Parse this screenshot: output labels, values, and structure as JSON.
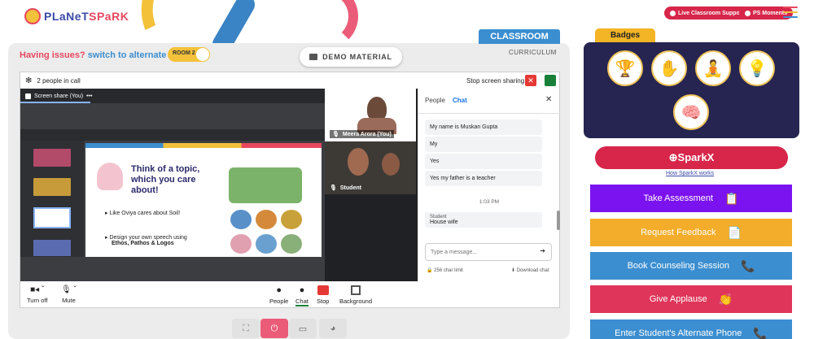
{
  "header": {
    "logo_text_a": "PLaNeT",
    "logo_text_b": "SPaRK",
    "live_support": "Live Classroom Support",
    "ps_moments": "PS Moments"
  },
  "classroom": {
    "tab_label": "CLASSROOM",
    "curriculum_label": "CURRICULUM",
    "issue_text": "Having issues?",
    "issue_link": "switch to alternate room",
    "room_toggle": "ROOM 2",
    "demo_material": "DEMO MATERIAL"
  },
  "meet": {
    "people_count": "2 people in call",
    "stop_sharing": "Stop screen sharing",
    "screen_share_label": "Screen share (You)",
    "slide_title": "Think of a topic, which you care about!",
    "slide_point1": "Like Oviya cares about Soil!",
    "slide_point2a": "Design your own speech using",
    "slide_point2b": "Ethos, Pathos & Logos",
    "tile_teacher": "Meera Arora (You)",
    "tile_student": "Student",
    "chat_tabs": {
      "people": "People",
      "chat": "Chat"
    },
    "messages": [
      "My name is Muskan Gupta",
      "My",
      "Yes",
      "Yes my father is a teacher"
    ],
    "chat_time": "1:03 PM",
    "last_sender": "Student",
    "last_message": "House wife",
    "chat_placeholder": "Type a message...",
    "char_limit": "256 char limit",
    "download_chat": "Download chat",
    "controls": {
      "turn_off": "Turn off",
      "mute": "Mute",
      "people": "People",
      "chat": "Chat",
      "stop": "Stop",
      "background": "Background"
    }
  },
  "badges": {
    "title": "Badges",
    "sparkx": "SparkX",
    "how_sparkx": "How SparkX works"
  },
  "actions": [
    {
      "label": "Take Assessment",
      "color": "#7b12f0"
    },
    {
      "label": "Request Feedback",
      "color": "#f3ad2a"
    },
    {
      "label": "Book Counseling Session",
      "color": "#3b8ed0"
    },
    {
      "label": "Give Applause",
      "color": "#e0355a"
    },
    {
      "label": "Enter Student's Alternate Phone",
      "color": "#3b8ed0"
    }
  ]
}
